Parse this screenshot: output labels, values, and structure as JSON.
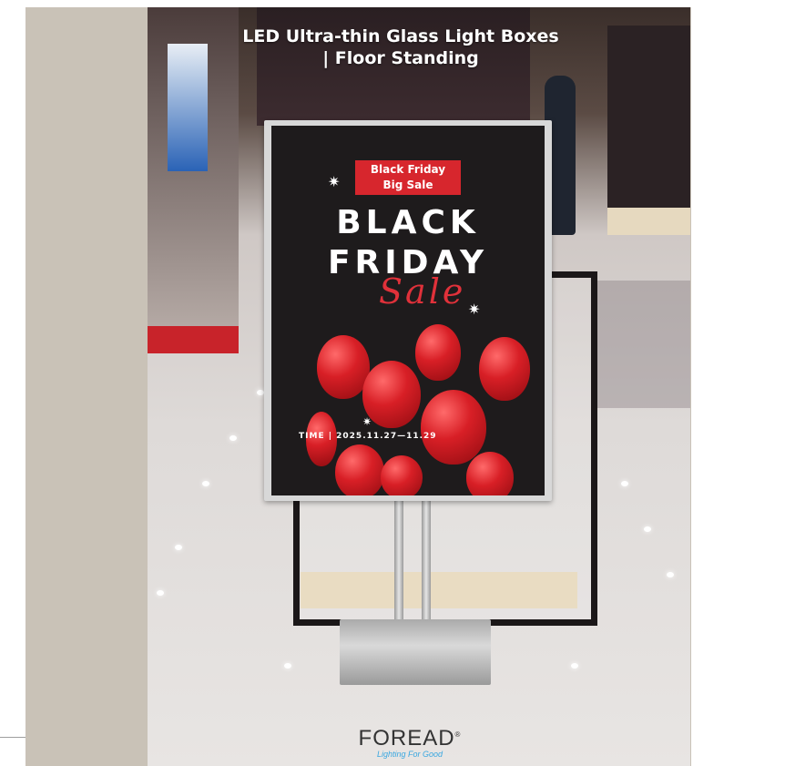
{
  "title": {
    "line1": "LED Ultra-thin Glass Light Boxes",
    "line2": "| Floor Standing"
  },
  "poster": {
    "badge_line1": "Black Friday",
    "badge_line2": "Big Sale",
    "headline_line1": "BLACK",
    "headline_line2": "FRIDAY",
    "script_word": "Sale",
    "time_text": "TIME | 2025.11.27—11.29"
  },
  "logo": {
    "brand": "FOREAD",
    "mark": "®",
    "tagline": "Lighting For Good"
  },
  "colors": {
    "frame": "#c9c2b7",
    "poster_bg": "#1e1b1c",
    "accent_red": "#d7262d",
    "logo_blue": "#3aa7e0"
  }
}
